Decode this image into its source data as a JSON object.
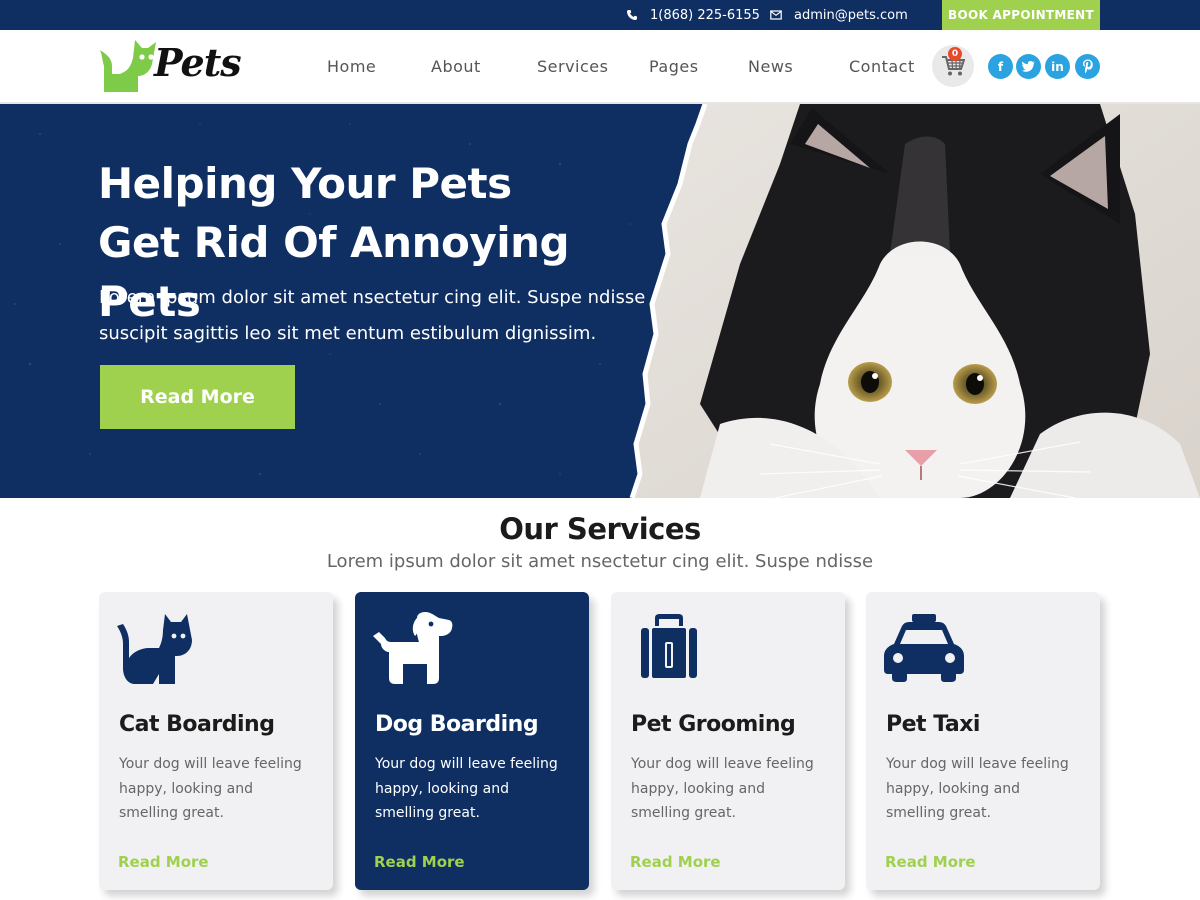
{
  "topbar": {
    "phone": "1(868) 225-6155",
    "email": "admin@pets.com",
    "book_label": "BOOK APPOINTMENT"
  },
  "header": {
    "logo_text": "Pets",
    "nav": [
      "Home",
      "About",
      "Services",
      "Pages",
      "News",
      "Contact"
    ],
    "cart_count": "0",
    "social": [
      "f",
      "t",
      "in",
      "p"
    ]
  },
  "hero": {
    "title_line1": "Helping Your Pets",
    "title_line2": "Get Rid Of Annoying Pets",
    "subtitle_line1": "Lorem ipsum dolor sit amet nsectetur cing elit. Suspe ndisse",
    "subtitle_line2": "suscipit sagittis leo sit met entum estibulum dignissim.",
    "button_label": "Read More"
  },
  "services": {
    "title": "Our Services",
    "subtitle": "Lorem ipsum dolor sit amet nsectetur cing elit. Suspe ndisse",
    "cards": [
      {
        "title": "Cat Boarding",
        "text_line1": "Your dog will leave feeling",
        "text_line2": "happy, looking and",
        "text_line3": "smelling great.",
        "link": "Read More",
        "icon": "cat-icon"
      },
      {
        "title": "Dog Boarding",
        "text_line1": "Your dog will leave feeling",
        "text_line2": "happy, looking and",
        "text_line3": "smelling great.",
        "link": "Read More",
        "icon": "dog-icon"
      },
      {
        "title": "Pet Grooming",
        "text_line1": "Your dog will leave feeling",
        "text_line2": "happy, looking and",
        "text_line3": "smelling great.",
        "link": "Read More",
        "icon": "suitcase-icon"
      },
      {
        "title": "Pet Taxi",
        "text_line1": "Your dog will leave feeling",
        "text_line2": "happy, looking and",
        "text_line3": "smelling great.",
        "link": "Read More",
        "icon": "taxi-icon"
      }
    ]
  },
  "colors": {
    "navy": "#0f2f63",
    "green": "#9fd14f",
    "social_blue": "#2aa3e0"
  }
}
